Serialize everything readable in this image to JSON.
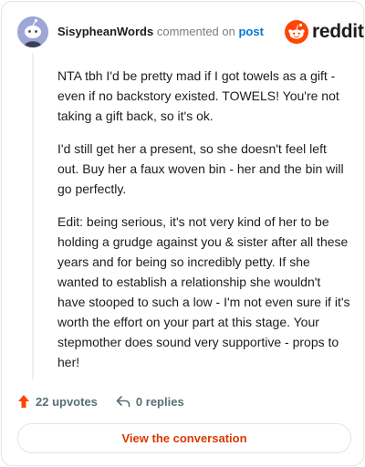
{
  "header": {
    "username": "SisypheanWords",
    "commented_on": "commented on",
    "post_link": "post"
  },
  "logo": {
    "wordmark": "reddit",
    "icon": "reddit-snoo-icon",
    "brand_color": "#ff4500"
  },
  "comment": {
    "paragraphs": [
      "NTA tbh I'd be pretty mad if I got towels as a gift - even if no backstory existed. TOWELS! You're not taking a gift back, so it's ok.",
      "I'd still get her a present, so she doesn't feel left out. Buy her a faux woven bin - her and the bin will go perfectly.",
      "Edit: being serious, it's not very kind of her to be holding a grudge against you & sister after all these years and for being so incredibly petty. If she wanted to establish a relationship she wouldn't have stooped to such a low - I'm not even sure if it's worth the effort on your part at this stage. Your stepmother does sound very supportive - props to her!"
    ]
  },
  "actions": {
    "upvotes": "22 upvotes",
    "replies": "0 replies",
    "upvote_icon": "upvote-arrow-icon",
    "reply_icon": "reply-arrow-icon",
    "upvote_color": "#ff4500"
  },
  "footer": {
    "view_button": "View the conversation",
    "accent": "#d93a00"
  }
}
